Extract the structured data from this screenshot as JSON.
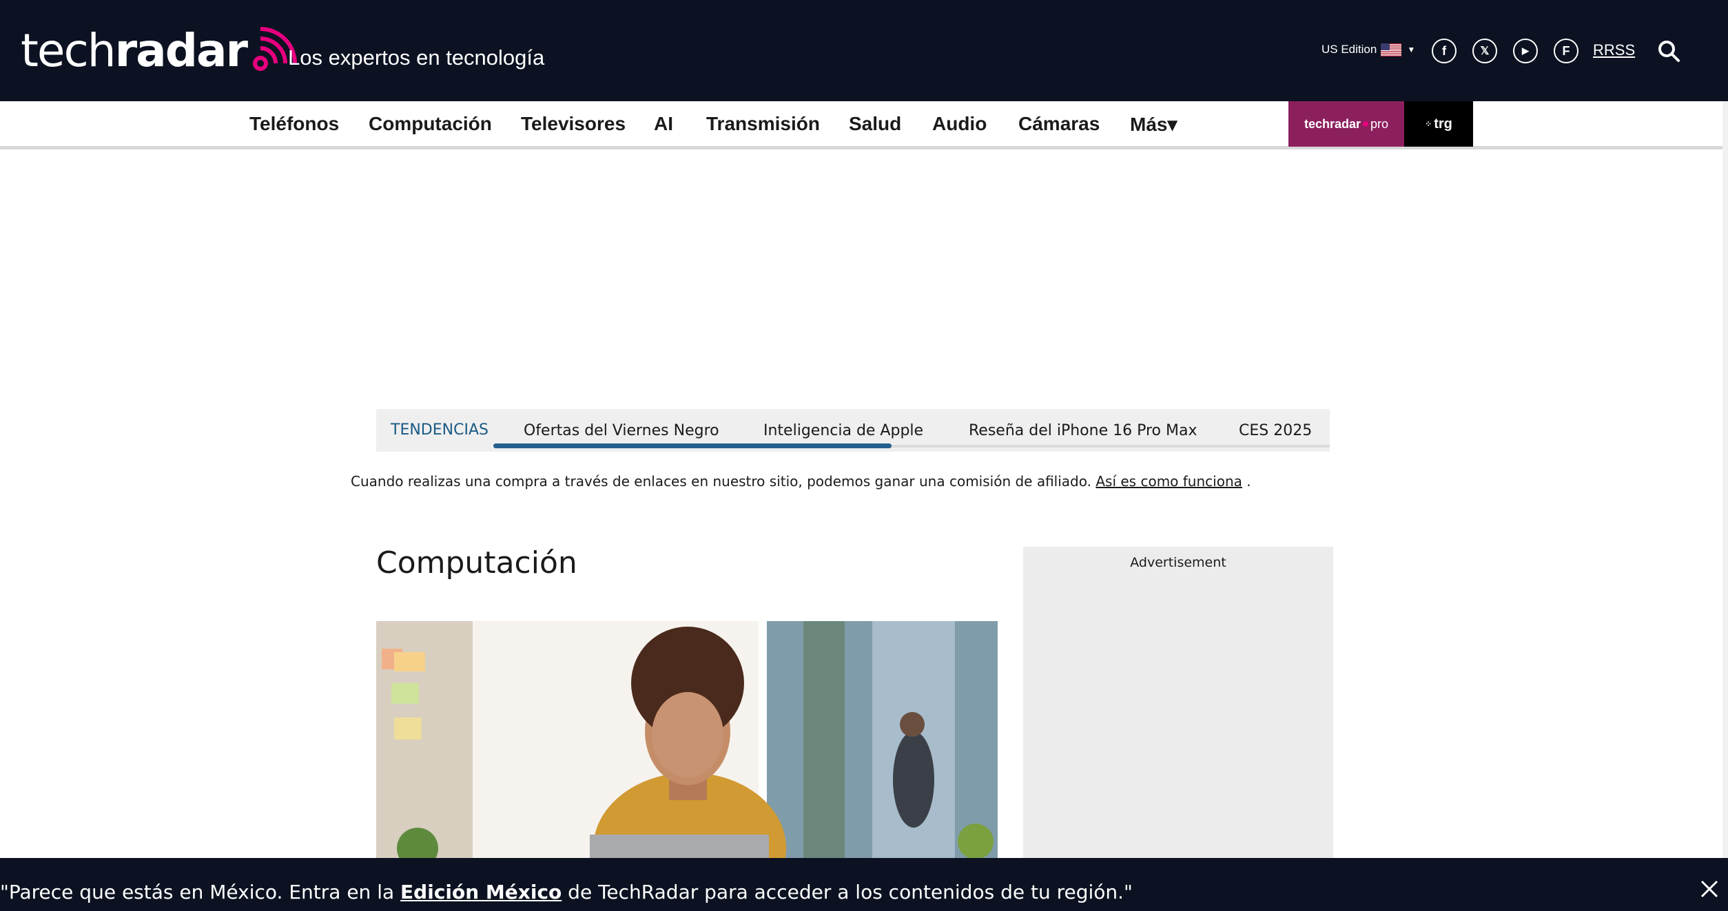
{
  "header": {
    "logo": {
      "light": "tech",
      "bold": "radar"
    },
    "tagline": "Los expertos en tecnología",
    "edition": "US Edition",
    "social": [
      {
        "name": "facebook",
        "glyph": "f"
      },
      {
        "name": "x",
        "glyph": "𝕏"
      },
      {
        "name": "youtube",
        "glyph": "▶"
      },
      {
        "name": "flipboard",
        "glyph": "F"
      }
    ],
    "rss": "RRSS"
  },
  "nav": {
    "items": [
      "Teléfonos",
      "Computación",
      "Televisores",
      "AI",
      "Transmisión",
      "Salud",
      "Audio",
      "Cámaras",
      "Más▾"
    ],
    "badge_pro": {
      "brand": "techradar",
      "suffix": "pro"
    },
    "badge_trg": "trg"
  },
  "trending": {
    "label": "TENDENCIAS",
    "items": [
      "Ofertas del Viernes Negro",
      "Inteligencia de Apple",
      "Reseña del iPhone 16 Pro Max",
      "CES 2025"
    ]
  },
  "affiliate": {
    "text": "Cuando realizas una compra a través de enlaces en nuestro sitio, podemos ganar una comisión de afiliado.",
    "link": "Así es como funciona",
    "suffix": "."
  },
  "main": {
    "title": "Computación"
  },
  "sidebar": {
    "ad_label": "Advertisement"
  },
  "geo_banner": {
    "prefix": "\"Parece que estás en México. Entra en la ",
    "link": "Edición México",
    "suffix": " de TechRadar para acceder a los contenidos de tu región.\""
  },
  "colors": {
    "header_bg": "#0c1221",
    "accent_pink": "#e6007e",
    "trending_blue": "#1a5a85",
    "pro_badge": "#8c1f5e"
  }
}
